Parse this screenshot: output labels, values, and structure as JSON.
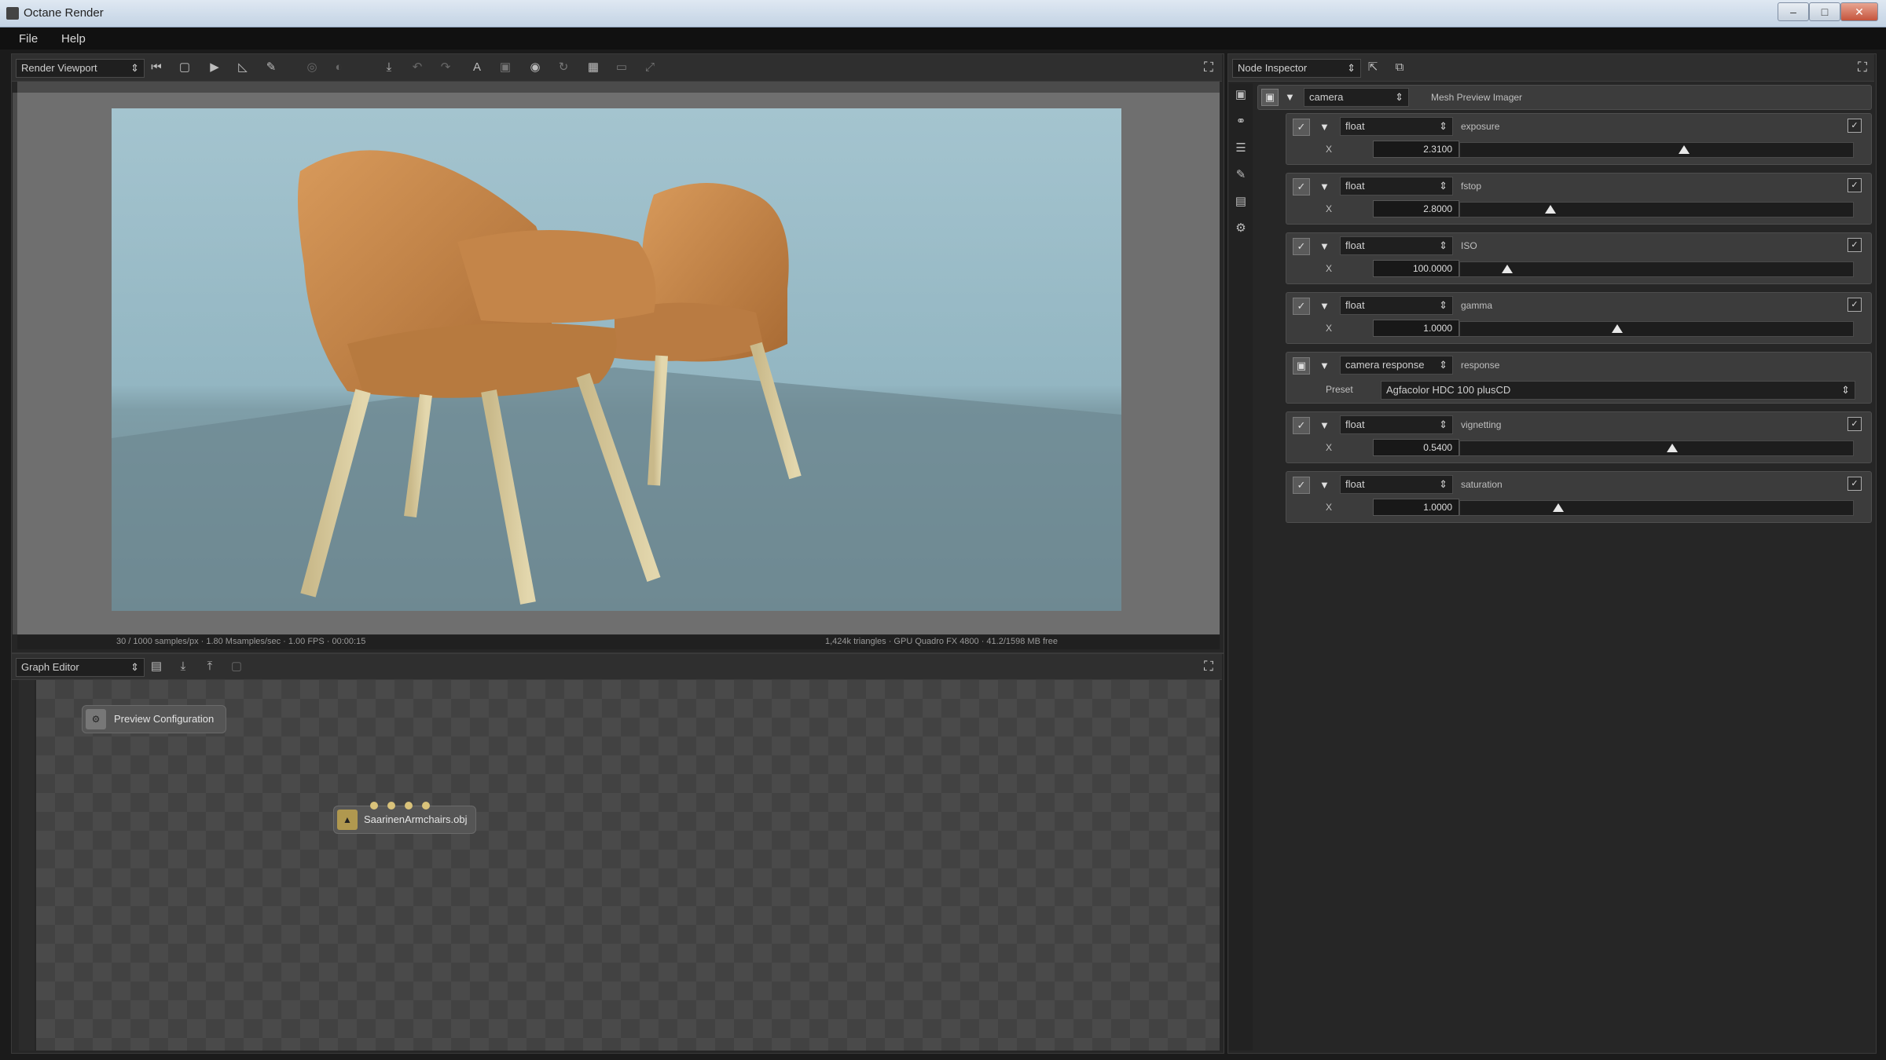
{
  "window": {
    "title": "Octane Render",
    "buttons": {
      "minimize": "–",
      "maximize": "□",
      "close": "✕"
    }
  },
  "menu": {
    "items": [
      "File",
      "Help"
    ]
  },
  "render_viewport": {
    "selector": "Render Viewport",
    "status_left": "30 / 1000 samples/px · 1.80 Msamples/sec · 1.00 FPS · 00:00:15",
    "status_right": "1,424k triangles · GPU Quadro FX 4800 · 41.2/1598 MB free"
  },
  "graph_editor": {
    "selector": "Graph Editor",
    "nodes": [
      {
        "label": "Preview Configuration",
        "icon": "config-icon"
      },
      {
        "label": "SaarinenArmchairs.obj",
        "icon": "mesh-icon"
      }
    ]
  },
  "node_inspector": {
    "selector": "Node Inspector",
    "root_type": "camera",
    "root_name": "Mesh Preview Imager",
    "params": [
      {
        "type": "float",
        "name": "exposure",
        "axis": "X",
        "value": "2.3100",
        "fraction": 0.57
      },
      {
        "type": "float",
        "name": "fstop",
        "axis": "X",
        "value": "2.8000",
        "fraction": 0.23
      },
      {
        "type": "float",
        "name": "ISO",
        "axis": "X",
        "value": "100.0000",
        "fraction": 0.12
      },
      {
        "type": "float",
        "name": "gamma",
        "axis": "X",
        "value": "1.0000",
        "fraction": 0.4
      },
      {
        "type": "float",
        "name": "vignetting",
        "axis": "X",
        "value": "0.5400",
        "fraction": 0.54
      },
      {
        "type": "float",
        "name": "saturation",
        "axis": "X",
        "value": "1.0000",
        "fraction": 0.25
      }
    ],
    "response": {
      "type": "camera response",
      "name": "response",
      "preset_label": "Preset",
      "preset_value": "Agfacolor HDC 100 plusCD"
    }
  },
  "colors": {
    "chair": "#c7874a",
    "background": "#1b1b1b",
    "panel": "#262626"
  }
}
